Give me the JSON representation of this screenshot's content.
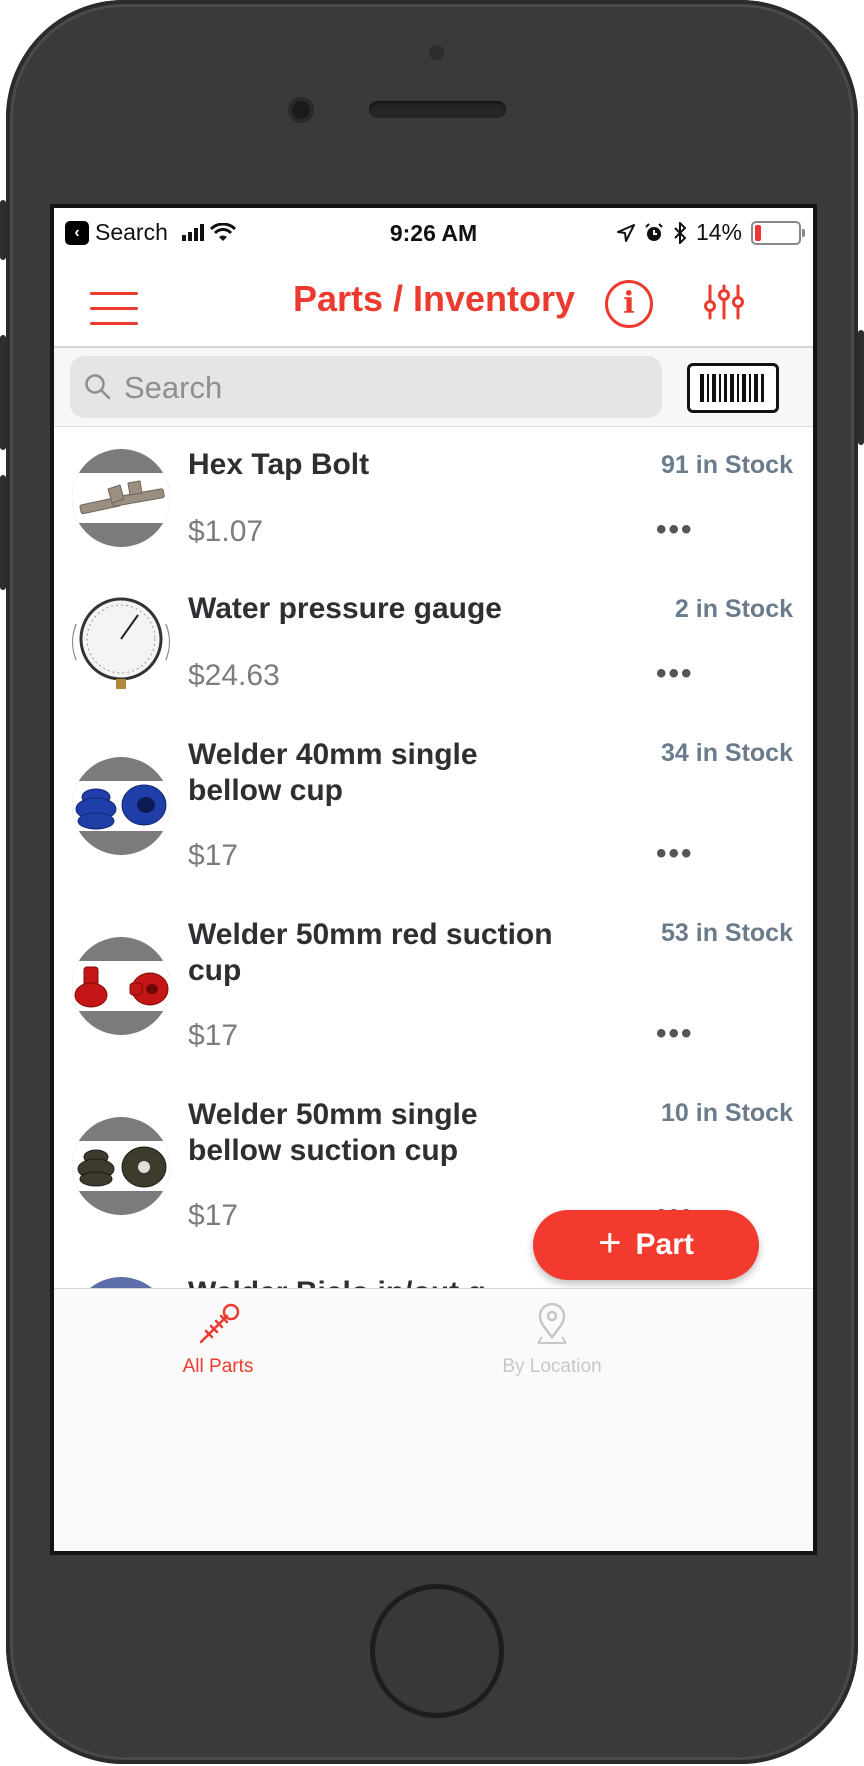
{
  "status_bar": {
    "back_app": "Search",
    "time": "9:26 AM",
    "battery": "14%",
    "battery_level": 0.14
  },
  "nav": {
    "title": "Parts / Inventory",
    "info_label": "i"
  },
  "search": {
    "placeholder": "Search"
  },
  "parts": [
    {
      "name": "Hex Tap Bolt",
      "price": "$1.07",
      "stock": "91 in Stock",
      "more": "•••"
    },
    {
      "name": "Water pressure gauge",
      "price": "$24.63",
      "stock": "2 in Stock",
      "more": "•••"
    },
    {
      "name": "Welder 40mm single bellow cup",
      "price": "$17",
      "stock": "34 in Stock",
      "more": "•••"
    },
    {
      "name": "Welder 50mm red suction cup",
      "price": "$17",
      "stock": "53 in Stock",
      "more": "•••"
    },
    {
      "name": "Welder 50mm single bellow suction cup",
      "price": "$17",
      "stock": "10 in Stock",
      "more": "•••"
    },
    {
      "name": "Welder Bielo in/out g",
      "price": "",
      "stock": "",
      "more": ""
    }
  ],
  "fab": {
    "plus": "+",
    "label": "Part"
  },
  "tabs": [
    {
      "label": "All Parts",
      "icon": "screw-icon",
      "active": true
    },
    {
      "label": "By Location",
      "icon": "location-pin-icon",
      "active": false
    }
  ],
  "colors": {
    "accent": "#ec3a2f",
    "stock_text": "#6a7b8c",
    "inactive_tab": "#c7c7c7"
  }
}
